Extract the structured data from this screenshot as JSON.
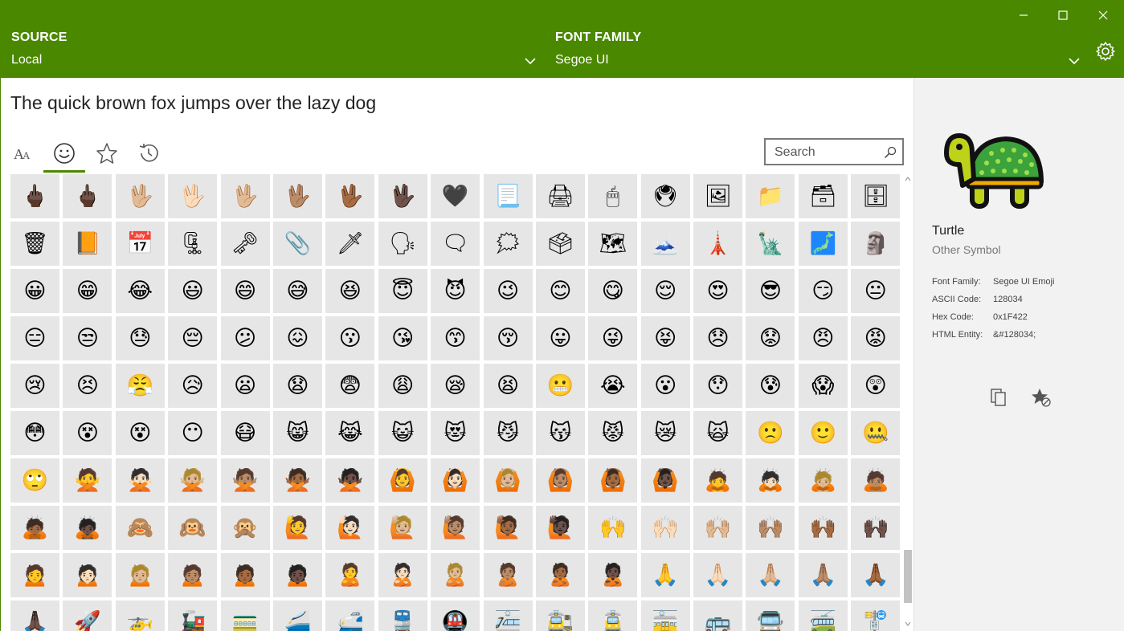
{
  "header": {
    "source_label": "SOURCE",
    "source_value": "Local",
    "family_label": "FONT FAMILY",
    "family_value": "Segoe UI",
    "accent_color": "#4a8800"
  },
  "window_controls": [
    "minimize-icon",
    "maximize-icon",
    "close-icon"
  ],
  "settings_icon": "gear-icon",
  "preview_text": "The quick brown fox jumps over the lazy dog",
  "tabs": [
    {
      "icon": "font-icon",
      "active": false
    },
    {
      "icon": "smiley-icon",
      "active": true
    },
    {
      "icon": "star-icon",
      "active": false
    },
    {
      "icon": "history-icon",
      "active": false
    }
  ],
  "search": {
    "placeholder": "Search"
  },
  "glyph_rows": [
    [
      "🖕🏿",
      "🖕🏿",
      "🖖🏼",
      "🖖🏻",
      "🖖🏼",
      "🖖🏽",
      "🖖🏾",
      "🖖🏿",
      "🖤",
      "📃",
      "🖨",
      "🖱",
      "🖲",
      "🖼",
      "📁",
      "🗃",
      "🗄"
    ],
    [
      "🗑",
      "📙",
      "📅",
      "🗜",
      "🗝",
      "📎",
      "🗡",
      "🗣",
      "🗨",
      "🗯",
      "🗳",
      "🗺",
      "🗻",
      "🗼",
      "🗽",
      "🗾",
      "🗿"
    ],
    [
      "😀",
      "😁",
      "😂",
      "😃",
      "😄",
      "😅",
      "😆",
      "😇",
      "😈",
      "😉",
      "😊",
      "😋",
      "😌",
      "😍",
      "😎",
      "😏",
      "😐"
    ],
    [
      "😑",
      "😒",
      "😓",
      "😔",
      "😕",
      "😖",
      "😗",
      "😘",
      "😙",
      "😚",
      "😛",
      "😜",
      "😝",
      "😞",
      "😟",
      "😠",
      "😡"
    ],
    [
      "😢",
      "😣",
      "😤",
      "😥",
      "😦",
      "😧",
      "😨",
      "😩",
      "😪",
      "😫",
      "😬",
      "😭",
      "😮",
      "😯",
      "😰",
      "😱",
      "😲"
    ],
    [
      "😳",
      "😵",
      "😵",
      "😶",
      "😷",
      "😸",
      "😹",
      "😺",
      "😻",
      "😼",
      "😽",
      "😾",
      "😿",
      "🙀",
      "🙁",
      "🙂",
      "🤐"
    ],
    [
      "🙄",
      "🙅",
      "🙅🏻",
      "🙅🏼",
      "🙅🏽",
      "🙅🏾",
      "🙅🏿",
      "🙆",
      "🙆🏻",
      "🙆🏼",
      "🙆🏽",
      "🙆🏾",
      "🙆🏿",
      "🙇",
      "🙇🏻",
      "🙇🏼",
      "🙇🏽"
    ],
    [
      "🙇🏾",
      "🙇🏿",
      "🙈",
      "🙉",
      "🙊",
      "🙋",
      "🙋🏻",
      "🙋🏼",
      "🙋🏽",
      "🙋🏾",
      "🙋🏿",
      "🙌",
      "🙌🏻",
      "🙌🏼",
      "🙌🏽",
      "🙌🏾",
      "🙌🏿"
    ],
    [
      "🙍",
      "🙍🏻",
      "🙍🏼",
      "🙍🏽",
      "🙍🏾",
      "🙍🏿",
      "🙎",
      "🙎🏻",
      "🙎🏼",
      "🙎🏽",
      "🙎🏾",
      "🙎🏿",
      "🙏",
      "🙏🏻",
      "🙏🏼",
      "🙏🏽",
      "🙏🏾"
    ],
    [
      "🙏🏿",
      "🚀",
      "🚁",
      "🚂",
      "🚃",
      "🚄",
      "🚅",
      "🚆",
      "🚇",
      "🚈",
      "🚉",
      "🚊",
      "🚋",
      "🚌",
      "🚍",
      "🚎",
      "🚏"
    ]
  ],
  "selected": {
    "name": "Turtle",
    "category": "Other Symbol",
    "details": [
      {
        "key": "Font Family:",
        "value": "Segoe UI Emoji"
      },
      {
        "key": "ASCII Code:",
        "value": "128034"
      },
      {
        "key": "Hex Code:",
        "value": "0x1F422"
      },
      {
        "key": "HTML Entity:",
        "value": "&#128034;"
      }
    ],
    "actions": [
      "copy-icon",
      "favorite-add-icon"
    ]
  }
}
